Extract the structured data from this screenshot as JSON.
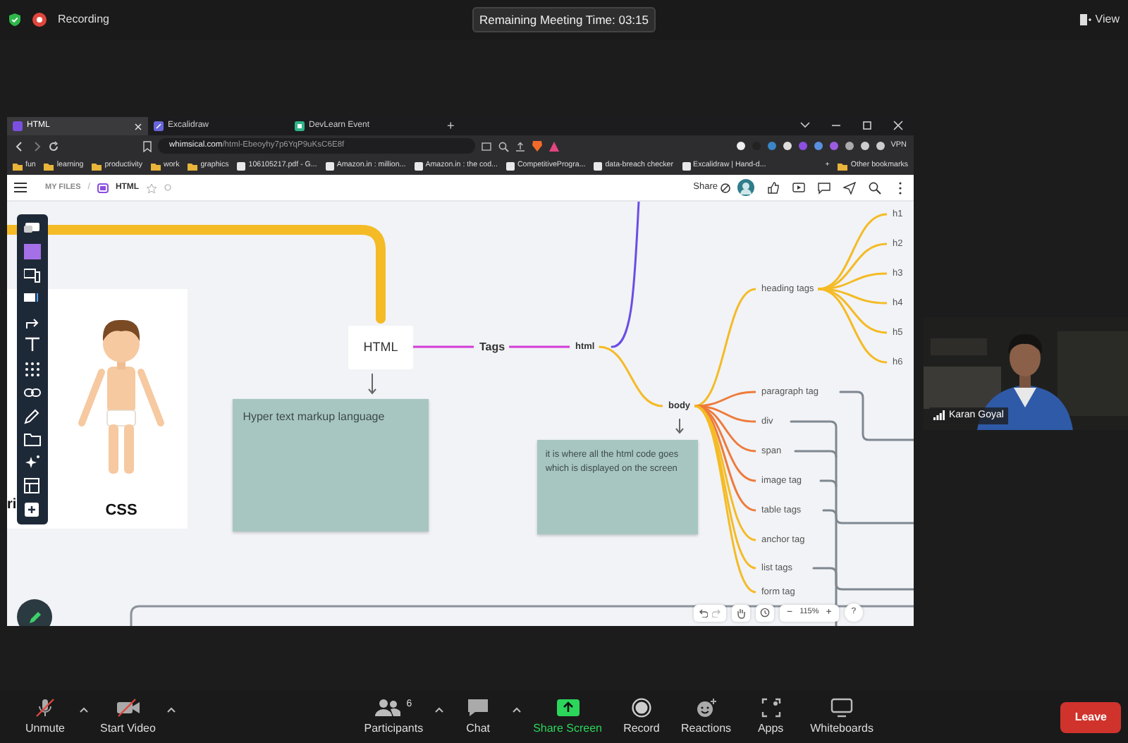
{
  "meeting": {
    "recording_label": "Recording",
    "time_remaining": "Remaining Meeting Time: 03:15",
    "view_label": "View"
  },
  "browser": {
    "tabs": [
      {
        "label": "HTML",
        "selected": true
      },
      {
        "label": "Excalidraw",
        "selected": false
      },
      {
        "label": "DevLearn Event",
        "selected": false
      }
    ],
    "new_tab": "+",
    "url_host": "whimsical.com",
    "url_path": "/html-Ebeoyhy7p6YqP9uKsC6E8f",
    "vpn": "VPN",
    "bookmarks": [
      {
        "kind": "folder",
        "label": "fun"
      },
      {
        "kind": "folder",
        "label": "learning"
      },
      {
        "kind": "folder",
        "label": "productivity"
      },
      {
        "kind": "folder",
        "label": "work"
      },
      {
        "kind": "folder",
        "label": "graphics"
      },
      {
        "kind": "page",
        "label": "106105217.pdf - G..."
      },
      {
        "kind": "page",
        "label": "Amazon.in : million..."
      },
      {
        "kind": "page",
        "label": "Amazon.in : the cod..."
      },
      {
        "kind": "page",
        "label": "CompetitiveProgra..."
      },
      {
        "kind": "page",
        "label": "data-breach checker"
      },
      {
        "kind": "page",
        "label": "Excalidraw | Hand-d..."
      }
    ],
    "bookmarks_more": "+",
    "other_bookmarks": "Other bookmarks"
  },
  "app": {
    "breadcrumb": "MY FILES",
    "separator": "/",
    "title": "HTML",
    "share": "Share",
    "mind_map": {
      "image_caption": "CSS",
      "cut_text": "ri",
      "root": {
        "label": "HTML",
        "note": "Hyper text markup language",
        "children": [
          {
            "label": "Tags",
            "children": [
              {
                "label": "html",
                "children": [
                  {
                    "label": "body",
                    "note": "it is where all the html code goes which is displayed on the screen",
                    "children": [
                      {
                        "label": "heading tags",
                        "children": [
                          {
                            "label": "h1"
                          },
                          {
                            "label": "h2"
                          },
                          {
                            "label": "h3"
                          },
                          {
                            "label": "h4"
                          },
                          {
                            "label": "h5"
                          },
                          {
                            "label": "h6"
                          }
                        ]
                      },
                      {
                        "label": "paragraph tag"
                      },
                      {
                        "label": "div"
                      },
                      {
                        "label": "span"
                      },
                      {
                        "label": "image tag"
                      },
                      {
                        "label": "table tags"
                      },
                      {
                        "label": "anchor tag"
                      },
                      {
                        "label": "list tags"
                      },
                      {
                        "label": "form tag"
                      }
                    ]
                  }
                ]
              }
            ]
          }
        ]
      }
    },
    "zoom": {
      "minus": "−",
      "level": "115%",
      "plus": "+",
      "help": "?"
    }
  },
  "video": {
    "name": "Karan Goyal"
  },
  "toolbar": [
    {
      "kind": "audio",
      "label": "Unmute",
      "muted": true,
      "caret": true
    },
    {
      "kind": "video",
      "label": "Start Video",
      "muted": true,
      "caret": true
    },
    {
      "kind": "participants",
      "label": "Participants",
      "count": "6",
      "caret": true
    },
    {
      "kind": "chat",
      "label": "Chat",
      "caret": true
    },
    {
      "kind": "share",
      "label": "Share Screen",
      "caret": false
    },
    {
      "kind": "record",
      "label": "Record",
      "caret": false
    },
    {
      "kind": "reactions",
      "label": "Reactions",
      "caret": false
    },
    {
      "kind": "apps",
      "label": "Apps",
      "caret": false
    },
    {
      "kind": "whiteboards",
      "label": "Whiteboards",
      "caret": false
    }
  ],
  "leave": "Leave"
}
